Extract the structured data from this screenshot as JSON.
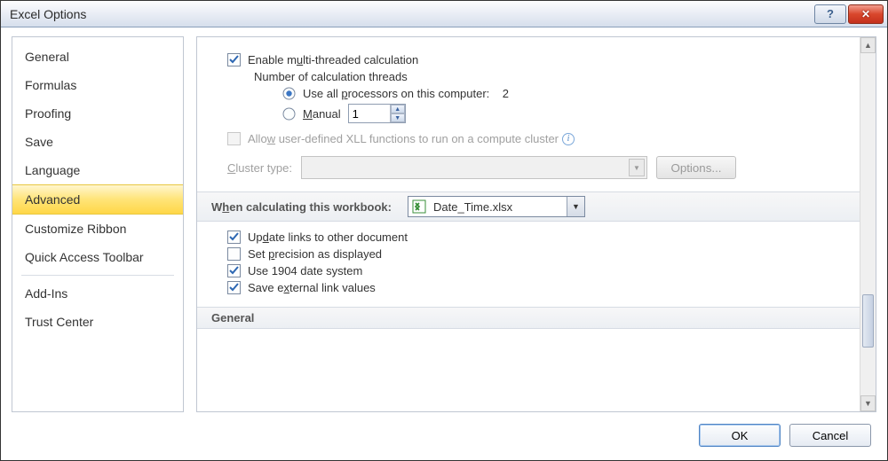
{
  "window": {
    "title": "Excel Options"
  },
  "sidebar": {
    "items": [
      {
        "label": "General"
      },
      {
        "label": "Formulas"
      },
      {
        "label": "Proofing"
      },
      {
        "label": "Save"
      },
      {
        "label": "Language"
      },
      {
        "label": "Advanced",
        "selected": true
      },
      {
        "label": "Customize Ribbon"
      },
      {
        "label": "Quick Access Toolbar"
      },
      {
        "label": "Add-Ins"
      },
      {
        "label": "Trust Center"
      }
    ]
  },
  "calc": {
    "enable_label_pre": "Enable m",
    "enable_label_u": "u",
    "enable_label_post": "lti-threaded calculation",
    "enable_checked": true,
    "threads_label": "Number of calculation threads",
    "use_all_label_pre": "Use all ",
    "use_all_u": "p",
    "use_all_label_post": "rocessors on this computer:",
    "processor_count": "2",
    "manual_label_u": "M",
    "manual_label_post": "anual",
    "manual_value": "1",
    "selected_radio": "use_all",
    "xll_label_pre": "Allo",
    "xll_u": "w",
    "xll_label_post": " user-defined XLL functions to run on a compute cluster",
    "xll_checked": false,
    "cluster_type_u": "C",
    "cluster_type_post": "luster type:",
    "options_label": "Options..."
  },
  "wb_section": {
    "header_pre": "W",
    "header_u": "h",
    "header_post": "en calculating this workbook:",
    "selected_workbook": "Date_Time.xlsx",
    "update_links_pre": "Up",
    "update_links_u": "d",
    "update_links_post": "ate links to other document",
    "update_links_checked": true,
    "precision_pre": "Set ",
    "precision_u": "p",
    "precision_post": "recision as displayed",
    "precision_checked": false,
    "date1904_label": "Use 1904 date system",
    "date1904_checked": true,
    "save_ext_pre": "Save e",
    "save_ext_u": "x",
    "save_ext_post": "ternal link values",
    "save_ext_checked": true
  },
  "general_section": {
    "header": "General"
  },
  "footer": {
    "ok": "OK",
    "cancel": "Cancel"
  }
}
